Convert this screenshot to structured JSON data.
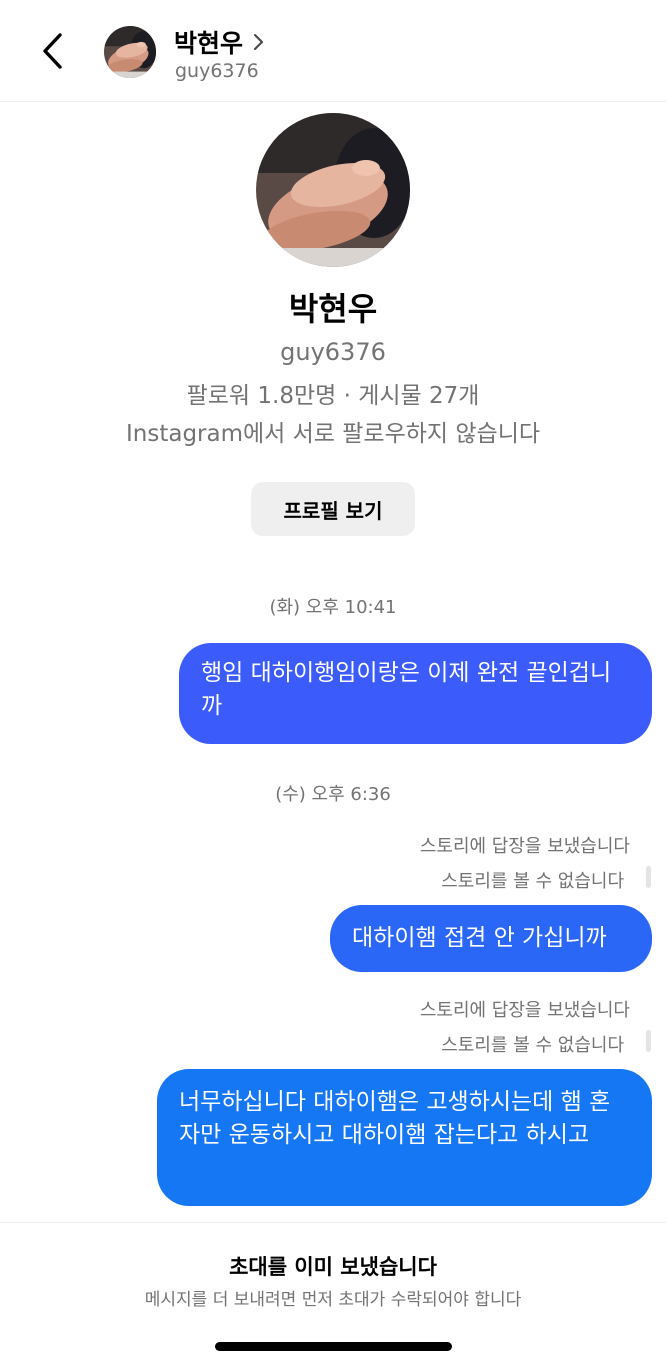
{
  "header": {
    "back_icon": "chevron-left-icon",
    "name": "박현우",
    "chevron_icon": "chevron-right-icon",
    "handle": "guy6376"
  },
  "profile": {
    "name": "박현우",
    "handle": "guy6376",
    "stats": "팔로워 1.8만명 · 게시물 27개",
    "mutual": "Instagram에서 서로 팔로우하지 않습니다",
    "view_profile_label": "프로필 보기"
  },
  "thread": {
    "timestamp_1": "(화) 오후 10:41",
    "message_1": "행임 대하이행임이랑은 이제 완전 끝인겁니까",
    "timestamp_2": "(수) 오후 6:36",
    "story_reply_1": "스토리에 답장을 보냈습니다",
    "story_unavailable_1": "스토리를 볼 수 없습니다",
    "message_2": "대하이햄 접견 안 가십니까",
    "story_reply_2": "스토리에 답장을 보냈습니다",
    "story_unavailable_2": "스토리를 볼 수 없습니다",
    "message_3": "너무하십니다 대하이햄은 고생하시는데 햄 혼자만 운동하시고 대하이햄 잡는다고 하시고"
  },
  "footer": {
    "title": "초대를 이미 보냈습니다",
    "subtitle": "메시지를 더 보내려면 먼저 초대가 수락되어야 합니다"
  },
  "colors": {
    "bubble_1": "#3b5bfa",
    "bubble_2": "#2a67f7",
    "bubble_3": "#1677f5",
    "secondary_text": "#737373"
  }
}
